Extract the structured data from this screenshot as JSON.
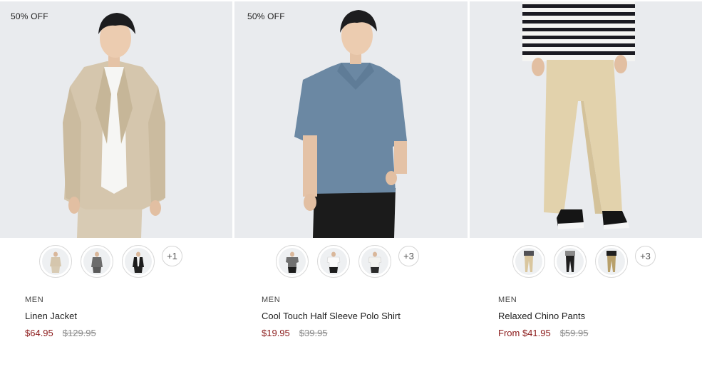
{
  "colors": {
    "photo_background": "#e9ebee",
    "sale_price": "#8b1a1a",
    "original_price": "#8a8a8a"
  },
  "products": [
    {
      "badge": "50% OFF",
      "image": "model-linen-jacket-photo",
      "swatch_images": [
        "beige-jacket-swatch",
        "grey-jacket-swatch",
        "black-jacket-swatch"
      ],
      "more_colors": "+1",
      "category": "MEN",
      "name": "Linen Jacket",
      "sale_price": "$64.95",
      "original_price": "$129.95"
    },
    {
      "badge": "50% OFF",
      "image": "model-polo-shirt-photo",
      "swatch_images": [
        "grey-polo-swatch",
        "white-polo-swatch",
        "light-polo-swatch"
      ],
      "more_colors": "+3",
      "category": "MEN",
      "name": "Cool Touch Half Sleeve Polo Shirt",
      "sale_price": "$19.95",
      "original_price": "$39.95"
    },
    {
      "badge": "",
      "image": "model-chino-pants-photo",
      "swatch_images": [
        "beige-chino-swatch",
        "black-chino-swatch",
        "khaki-chino-swatch"
      ],
      "more_colors": "+3",
      "category": "MEN",
      "name": "Relaxed Chino Pants",
      "sale_price": "From $41.95",
      "original_price": "$59.95"
    }
  ]
}
